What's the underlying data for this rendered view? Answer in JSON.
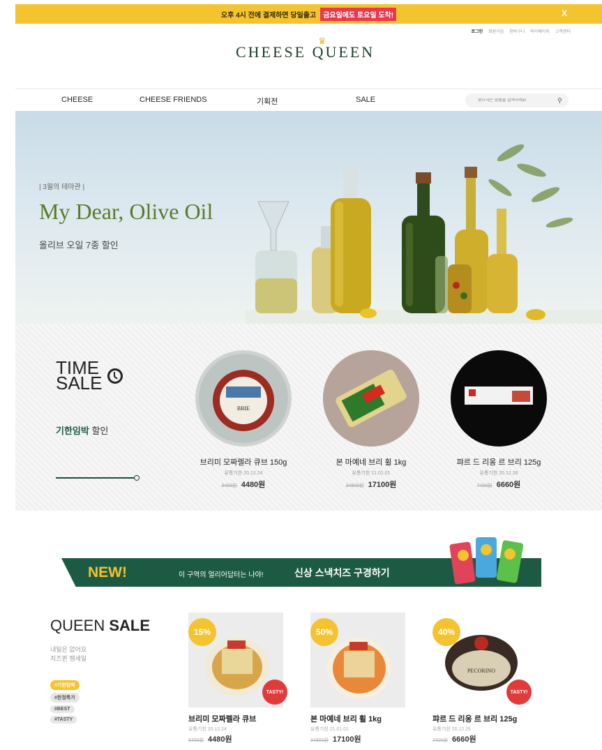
{
  "topbar": {
    "text": "오후 4시 전에 결제하면 당일출고",
    "highlight": "금요일에도 토요일 도착!",
    "close": "X"
  },
  "util_menu": [
    "로그인",
    "회원가입",
    "장바구니",
    "마이페이지",
    "고객센터"
  ],
  "brand": {
    "logo": "CHEESE QUEEN",
    "crown_icon": "crown-icon"
  },
  "nav": {
    "items": [
      "CHEESE",
      "CHEESE FRIENDS",
      "기획전",
      "SALE"
    ],
    "search_placeholder": "찾으시는 상품을 검색하세요",
    "search_icon": "search-icon"
  },
  "hero": {
    "theme": "| 3월의 테마관 |",
    "title": "My Dear, Olive Oil",
    "subtitle": "올리브 오일 7종 할인"
  },
  "time_sale": {
    "title_line1": "TIME",
    "title_line2": "SALE",
    "clock_icon": "clock-icon",
    "desc_bold": "기한임박",
    "desc_rest": " 할인",
    "items": [
      {
        "name": "브리미 모짜렐라 큐브 150g",
        "exp": "유통기한 20.12.24",
        "orig": "6400원",
        "price": "4480원"
      },
      {
        "name": "본 마예네 브리 휠 1kg",
        "exp": "유통기한 21.01.01",
        "orig": "34900원",
        "price": "17100원"
      },
      {
        "name": "퍄르 드 리옹 르 브리 125g",
        "exp": "유통기한 20.12.26",
        "orig": "7400원",
        "price": "6660원"
      }
    ]
  },
  "new_banner": {
    "new": "NEW!",
    "text1": "이 구역의 얼리어답터는 나야!",
    "text2": "신상 스낵치즈 구경하기"
  },
  "queen_sale": {
    "title_light": "QUEEN ",
    "title_bold": "SALE",
    "desc_line1": "내일은 없어요",
    "desc_line2": "치즈퀸 땡세일",
    "tags": [
      "#기한임박",
      "#한정특가",
      "#BEST",
      "#TASTY"
    ],
    "items": [
      {
        "pct": "15%",
        "badge": "TASTY!",
        "name": "브리미 모짜렐라 큐브",
        "exp": "유통기한 20.12.24",
        "orig": "6400원",
        "price": "4480원"
      },
      {
        "pct": "50%",
        "badge": "",
        "name": "본 마예네 브리 휠 1kg",
        "exp": "유통기한 21.01.01",
        "orig": "34900원",
        "price": "17100원"
      },
      {
        "pct": "40%",
        "badge": "TASTY!",
        "name": "퍄르 드 리옹 르 브리 125g",
        "exp": "유통기한 20.12.26",
        "orig": "7400원",
        "price": "6660원"
      }
    ]
  },
  "colors": {
    "accent": "#f4c430",
    "brand_green": "#1d5a43",
    "sale_red": "#e03b3b"
  }
}
